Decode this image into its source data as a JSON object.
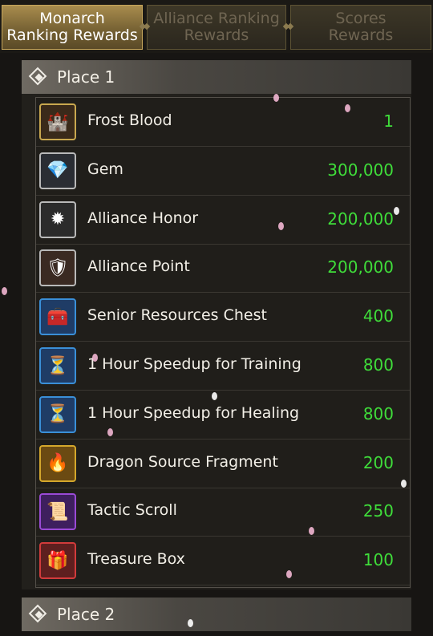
{
  "tabs": [
    {
      "label_line1": "Monarch",
      "label_line2": "Ranking Rewards",
      "active": true
    },
    {
      "label_line1": "Alliance Ranking",
      "label_line2": "Rewards",
      "active": false
    },
    {
      "label_line1": "Scores",
      "label_line2": "Rewards",
      "active": false
    }
  ],
  "place1": {
    "title": "Place 1",
    "rewards": [
      {
        "name": "Frost Blood",
        "amount": "1",
        "icon": "frost-blood-icon",
        "frame": "#c9a84f",
        "bg": "#3a2a1a",
        "glyph": "🏰"
      },
      {
        "name": "Gem",
        "amount": "300,000",
        "icon": "gem-icon",
        "frame": "#b9b9b9",
        "bg": "#2a2d33",
        "glyph": "💎"
      },
      {
        "name": "Alliance Honor",
        "amount": "200,000",
        "icon": "alliance-honor-icon",
        "frame": "#b9b9b9",
        "bg": "#2b2b2b",
        "glyph": "✹"
      },
      {
        "name": "Alliance Point",
        "amount": "200,000",
        "icon": "alliance-point-icon",
        "frame": "#b9b9b9",
        "bg": "#3a2a22",
        "glyph": "🛡"
      },
      {
        "name": "Senior Resources Chest",
        "amount": "400",
        "icon": "resources-chest-icon",
        "frame": "#3a8fd8",
        "bg": "#1f3c66",
        "glyph": "🧰"
      },
      {
        "name": "1 Hour Speedup for Training",
        "amount": "800",
        "icon": "speedup-training-icon",
        "frame": "#3a8fd8",
        "bg": "#1f3c66",
        "glyph": "⏳"
      },
      {
        "name": "1 Hour Speedup for Healing",
        "amount": "800",
        "icon": "speedup-healing-icon",
        "frame": "#3a8fd8",
        "bg": "#1f3c66",
        "glyph": "⏳"
      },
      {
        "name": "Dragon Source Fragment",
        "amount": "200",
        "icon": "dragon-fragment-icon",
        "frame": "#d4a72c",
        "bg": "#6b4a12",
        "glyph": "🔥"
      },
      {
        "name": "Tactic Scroll",
        "amount": "250",
        "icon": "tactic-scroll-icon",
        "frame": "#9a4ad6",
        "bg": "#3e1f5e",
        "glyph": "📜"
      },
      {
        "name": "Treasure Box",
        "amount": "100",
        "icon": "treasure-box-icon",
        "frame": "#d23b3b",
        "bg": "#5e1f1f",
        "glyph": "🎁"
      }
    ]
  },
  "place2": {
    "title": "Place 2"
  }
}
